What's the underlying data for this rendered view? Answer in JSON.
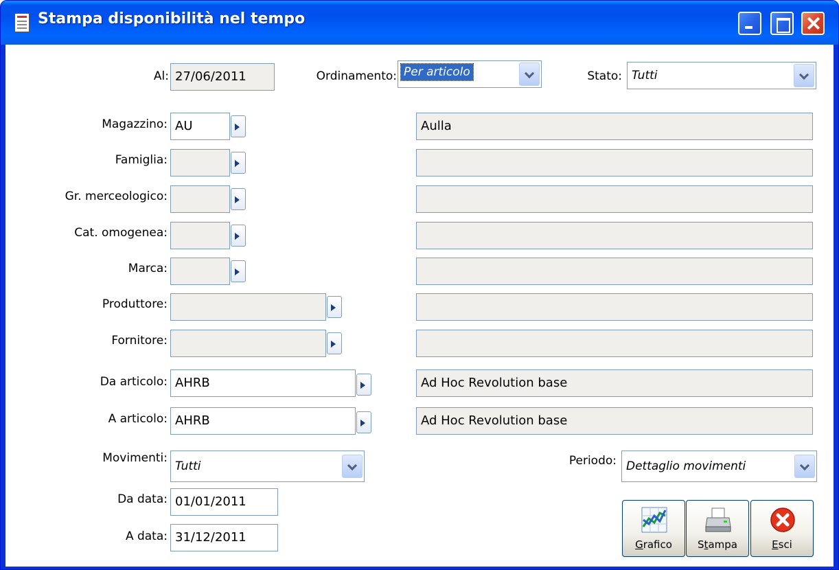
{
  "window": {
    "title": "Stampa disponibilità nel tempo",
    "accent_color": "#0054e3"
  },
  "header": {
    "al_label": "Al:",
    "al_value": "27/06/2011",
    "ordinamento_label": "Ordinamento:",
    "ordinamento_value": "Per articolo",
    "stato_label": "Stato:",
    "stato_value": "Tutti"
  },
  "filters": {
    "magazzino_label": "Magazzino:",
    "magazzino_code": "AU",
    "magazzino_desc": "Aulla",
    "famiglia_label": "Famiglia:",
    "famiglia_code": "",
    "famiglia_desc": "",
    "gruppo_label": "Gr. merceologico:",
    "gruppo_code": "",
    "gruppo_desc": "",
    "categoria_label": "Cat. omogenea:",
    "categoria_code": "",
    "categoria_desc": "",
    "marca_label": "Marca:",
    "marca_code": "",
    "marca_desc": "",
    "produttore_label": "Produttore:",
    "produttore_code": "",
    "produttore_desc": "",
    "fornitore_label": "Fornitore:",
    "fornitore_code": "",
    "fornitore_desc": "",
    "da_articolo_label": "Da articolo:",
    "da_articolo_code": "AHRB",
    "da_articolo_desc": "Ad Hoc Revolution base",
    "a_articolo_label": "A articolo:",
    "a_articolo_code": "AHRB",
    "a_articolo_desc": "Ad Hoc Revolution base"
  },
  "footer": {
    "movimenti_label": "Movimenti:",
    "movimenti_value": "Tutti",
    "periodo_label": "Periodo:",
    "periodo_value": "Dettaglio movimenti",
    "da_data_label": "Da data:",
    "da_data_value": "01/01/2011",
    "a_data_label": "A data:",
    "a_data_value": "31/12/2011"
  },
  "buttons": {
    "grafico_hotkey": "G",
    "grafico_rest": "rafico",
    "stampa_first": "S",
    "stampa_hotkey": "t",
    "stampa_rest": "ampa",
    "esci_hotkey": "E",
    "esci_rest": "sci"
  }
}
